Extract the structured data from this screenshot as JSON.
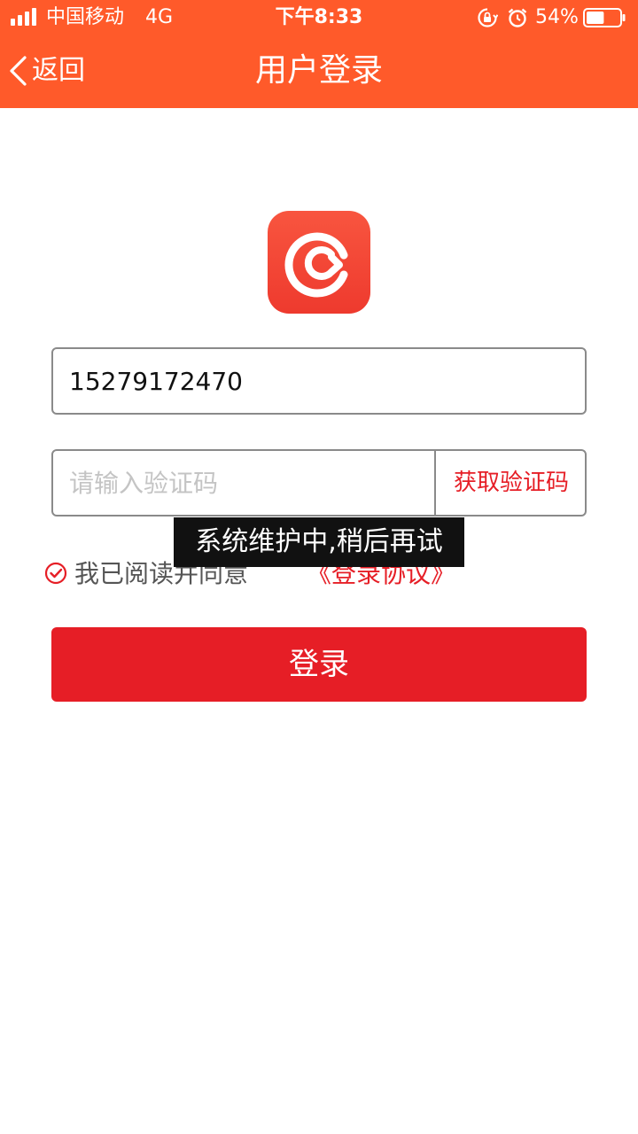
{
  "status_bar": {
    "carrier": "中国移动",
    "network": "4G",
    "time": "下午8:33",
    "battery_percent": "54%",
    "battery_level": 0.54,
    "icons": [
      "signal-icon",
      "orientation-lock-icon",
      "alarm-icon",
      "battery-icon"
    ]
  },
  "nav": {
    "back_label": "返回",
    "title": "用户登录",
    "back_icon": "chevron-left-icon"
  },
  "logo": {
    "icon": "app-logo-icon"
  },
  "form": {
    "phone_value": "15279172470",
    "code_placeholder": "请输入验证码",
    "code_value": "",
    "get_code_label": "获取验证码"
  },
  "agreement": {
    "checked": true,
    "text": "我已阅读并同意",
    "link_label": "《登录协议》",
    "check_icon": "check-circle-icon"
  },
  "toast": {
    "message": "系统维护中,稍后再试"
  },
  "login_button": {
    "label": "登录"
  },
  "colors": {
    "header_bg": "#FF5A2A",
    "accent_red": "#E61E26",
    "logo_red": "#F04A36"
  }
}
